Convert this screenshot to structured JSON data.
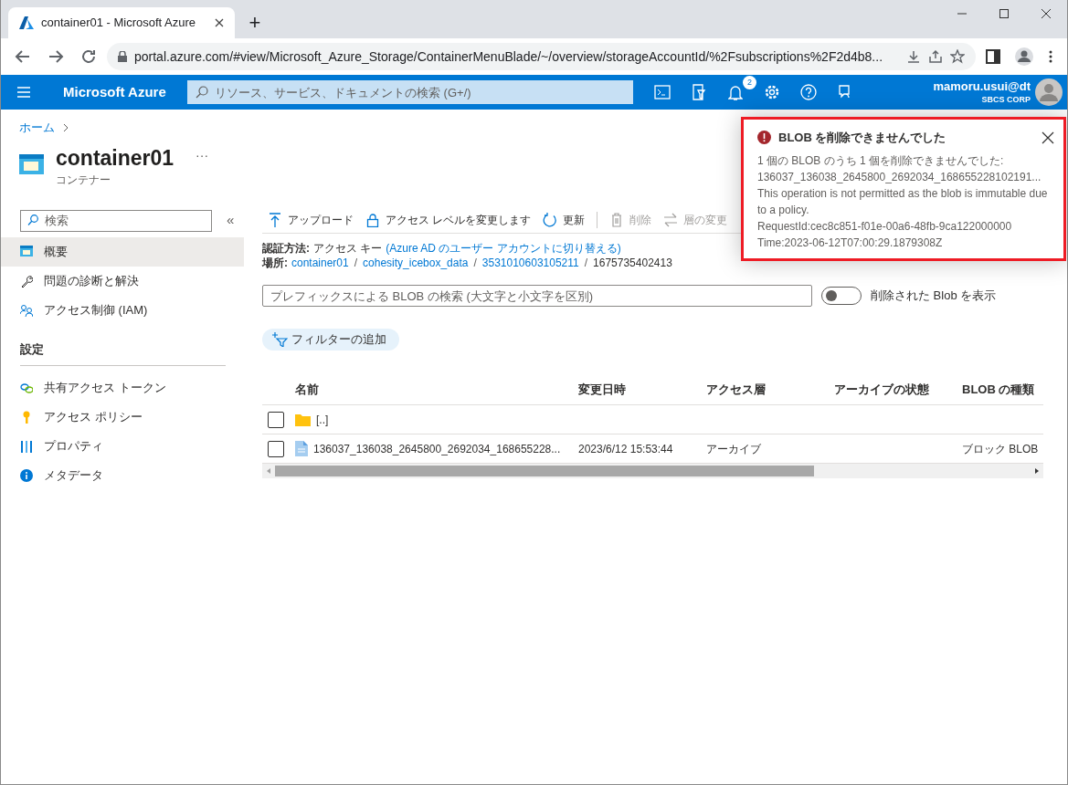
{
  "browser": {
    "tab_title": "container01 - Microsoft Azure",
    "new_tab": "+",
    "url": "portal.azure.com/#view/Microsoft_Azure_Storage/ContainerMenuBlade/~/overview/storageAccountId/%2Fsubscriptions%2F2d4b8..."
  },
  "header": {
    "brand": "Microsoft Azure",
    "search_placeholder": "リソース、サービス、ドキュメントの検索 (G+/)",
    "notification_count": "2",
    "user": "mamoru.usui@dt",
    "tenant": "SBCS CORP"
  },
  "breadcrumb": [
    {
      "label": "ホーム"
    }
  ],
  "resource": {
    "title": "container01",
    "more": "···",
    "subtitle": "コンテナー"
  },
  "sidebar": {
    "search_placeholder": "検索",
    "collapse": "«",
    "items": [
      {
        "kind": "item",
        "label": "概要",
        "selected": true
      },
      {
        "kind": "item",
        "label": "問題の診断と解決",
        "selected": false
      },
      {
        "kind": "item",
        "label": "アクセス制御 (IAM)",
        "selected": false
      },
      {
        "kind": "section",
        "label": "設定"
      },
      {
        "kind": "item",
        "label": "共有アクセス トークン",
        "selected": false
      },
      {
        "kind": "item",
        "label": "アクセス ポリシー",
        "selected": false
      },
      {
        "kind": "item",
        "label": "プロパティ",
        "selected": false
      },
      {
        "kind": "item",
        "label": "メタデータ",
        "selected": false
      }
    ]
  },
  "toolbar": [
    {
      "label": "アップロード",
      "disabled": false
    },
    {
      "label": "アクセス レベルを変更します",
      "disabled": false
    },
    {
      "label": "更新",
      "disabled": false
    },
    {
      "label": "削除",
      "disabled": true
    },
    {
      "label": "層の変更",
      "disabled": true
    }
  ],
  "auth": {
    "label": "認証方法:",
    "value": "アクセス キー",
    "link": "(Azure AD のユーザー アカウントに切り替える)"
  },
  "location": {
    "label": "場所:",
    "separators": [
      "/",
      "/",
      "/"
    ],
    "parts": [
      {
        "text": "container01",
        "link": true
      },
      {
        "text": "cohesity_icebox_data",
        "link": true
      },
      {
        "text": "3531010603105211",
        "link": true
      },
      {
        "text": "1675735402413",
        "link": false
      }
    ]
  },
  "blob_search": {
    "placeholder": "プレフィックスによる BLOB の検索 (大文字と小文字を区別)"
  },
  "show_deleted": {
    "label": "削除された Blob を表示",
    "on": false
  },
  "add_filter": "フィルターの追加",
  "table": {
    "columns": [
      "名前",
      "変更日時",
      "アクセス層",
      "アーカイブの状態",
      "BLOB の種類"
    ],
    "rows": [
      {
        "kind": "folder",
        "checked": false,
        "name": "[..]",
        "modified": "",
        "tier": "",
        "archive": "",
        "type": ""
      },
      {
        "kind": "file",
        "checked": false,
        "name": "136037_136038_2645800_2692034_168655228...",
        "modified": "2023/6/12 15:53:44",
        "tier": "アーカイブ",
        "archive": "",
        "type": "ブロック BLOB"
      }
    ]
  },
  "notification": {
    "title": "BLOB を削除できませんでした",
    "lines": [
      "1 個の BLOB のうち 1 個を削除できませんでした:",
      "136037_136038_2645800_2692034_168655228102191...",
      "This operation is not permitted as the blob is immutable due to a policy.",
      "RequestId:cec8c851-f01e-00a6-48fb-9ca122000000",
      "Time:2023-06-12T07:00:29.1879308Z"
    ]
  }
}
